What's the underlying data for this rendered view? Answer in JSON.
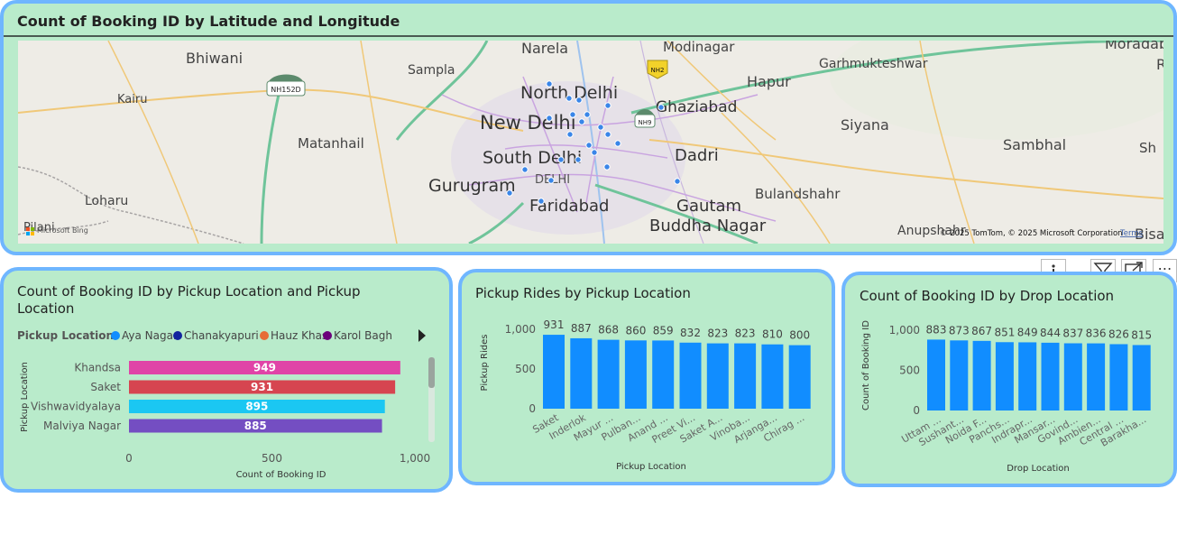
{
  "map_card": {
    "title": "Count of Booking ID by Latitude and Longitude",
    "places": [
      "Narela",
      "Modinagar",
      "Moradab",
      "R",
      "Bhiwani",
      "Sampla",
      "Hapur",
      "Garhmukteshwar",
      "Kairu",
      "North Delhi",
      "Ghaziabad",
      "New Delhi",
      "Siyana",
      "Matanhail",
      "South Delhi",
      "Dadri",
      "Sambhal",
      "Sh",
      "DELHI",
      "Gurugram",
      "Bulandshahr",
      "Loharu",
      "Faridabad",
      "Gautam",
      "Buddha Nagar",
      "Pilani",
      "Anupshahr",
      "Bisau"
    ],
    "road_badges": [
      "NH152D",
      "NH2",
      "NH9"
    ],
    "attribution": "© 2025 TomTom, © 2025 Microsoft Corporation",
    "terms": "Terms",
    "bing": "Microsoft Bing",
    "point_color": "#3a86e8"
  },
  "toolbar": {
    "icons": [
      "info-icon",
      "filter-icon",
      "focus-mode-icon",
      "more-options-icon"
    ],
    "more_glyph": "⋯"
  },
  "chart_data": [
    {
      "type": "bar",
      "orientation": "horizontal",
      "title": "Count of Booking ID by Pickup Location and Pickup Location",
      "legend_title": "Pickup Location",
      "legend": [
        {
          "name": "Aya Nagar",
          "color": "#118dff"
        },
        {
          "name": "Chanakyapuri",
          "color": "#12239e"
        },
        {
          "name": "Hauz Khas",
          "color": "#e66c37"
        },
        {
          "name": "Karol Bagh",
          "color": "#6b007b"
        }
      ],
      "categories": [
        "Khandsa",
        "Saket",
        "Vishwavidyalaya",
        "Malviya Nagar"
      ],
      "values": [
        949,
        931,
        895,
        885
      ],
      "colors": [
        "#e044a7",
        "#d64550",
        "#1bc7f2",
        "#744ec2"
      ],
      "xlabel": "Count of Booking ID",
      "ylabel": "Pickup Location",
      "xlim": [
        0,
        1000
      ],
      "ticks": [
        "0",
        "500",
        "1,000"
      ],
      "grid": false
    },
    {
      "type": "bar",
      "title": "Pickup Rides by Pickup Location",
      "categories": [
        "Saket",
        "Inderlok",
        "Mayur ...",
        "Pulban...",
        "Anand ...",
        "Preet Vi...",
        "Saket A...",
        "Vinoba...",
        "Arjanga...",
        "Chirag ..."
      ],
      "values": [
        931,
        887,
        868,
        860,
        859,
        832,
        823,
        823,
        810,
        800
      ],
      "xlabel": "Pickup Location",
      "ylabel": "Pickup Rides",
      "ylim": [
        0,
        1000
      ],
      "ticks": [
        "0",
        "500",
        "1,000"
      ],
      "color": "#118dff",
      "grid": false
    },
    {
      "type": "bar",
      "title": "Count of Booking ID by Drop Location",
      "categories": [
        "Uttam ...",
        "Sushant...",
        "Noida F...",
        "Panchs...",
        "Indrapr...",
        "Mansar...",
        "Govind...",
        "Ambien...",
        "Central ...",
        "Barakha..."
      ],
      "values": [
        883,
        873,
        867,
        851,
        849,
        844,
        837,
        836,
        826,
        815
      ],
      "xlabel": "Drop Location",
      "ylabel": "Count of Booking ID",
      "ylim": [
        0,
        1000
      ],
      "ticks": [
        "0",
        "500",
        "1,000"
      ],
      "color": "#118dff",
      "grid": false
    }
  ]
}
